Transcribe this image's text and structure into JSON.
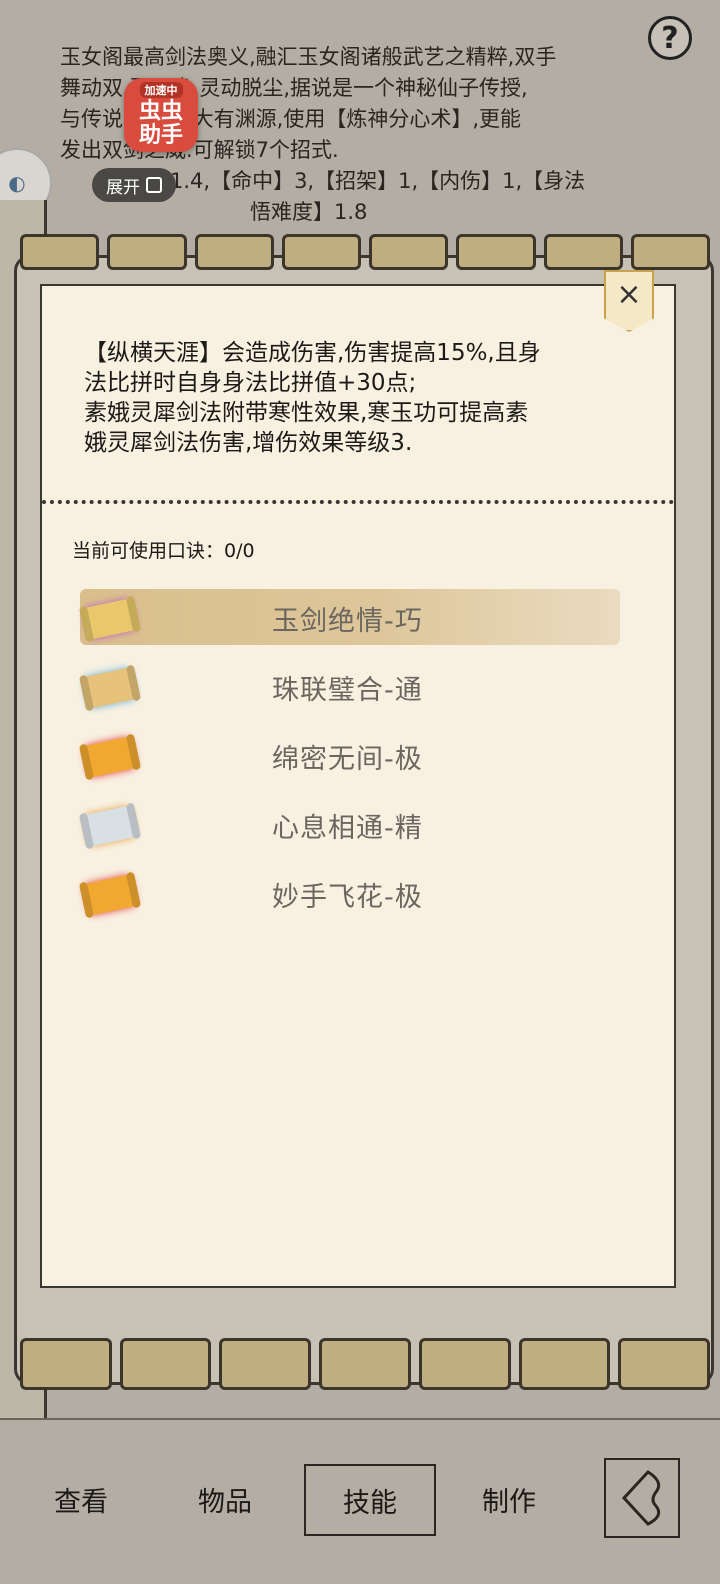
{
  "description": {
    "lines": [
      "玉女阁最高剑法奥义,融汇玉女阁诸般武艺之精粹,双手",
      "舞动双  盈飘逸,灵动脱尘,据说是一个神秘仙子传授,",
      "与传说  素娥墓大有渊源,使用【炼神分心术】,更能",
      "发出双剑之威.可解锁7个招式.",
      "1.4,【命中】3,【招架】1,【内伤】1,【身法",
      "悟难度】1.8"
    ]
  },
  "help_icon_text": "?",
  "overlay": {
    "badge_tag": "加速中",
    "badge_name": "虫虫助手",
    "expand_label": "展开"
  },
  "panel": {
    "close_symbol": "×",
    "effect_text": "【纵横天涯】会造成伤害,伤害提高15%,且身\n法比拼时自身身法比拼值+30点;\n素娥灵犀剑法附带寒性效果,寒玉功可提高素\n娥灵犀剑法伤害,增伤效果等级3.",
    "formula_status": "当前可使用口诀：0/0",
    "formulas": [
      {
        "label": "玉剑绝情-巧",
        "icon": "scroll-purple-icon",
        "color": "#e8c86a",
        "selected": true
      },
      {
        "label": "珠联璧合-通",
        "icon": "scroll-blue-icon",
        "color": "#e6c27a",
        "selected": false
      },
      {
        "label": "绵密无间-极",
        "icon": "scroll-red-icon",
        "color": "#f0a830",
        "selected": false
      },
      {
        "label": "心息相通-精",
        "icon": "scroll-white-icon",
        "color": "#d8e0e4",
        "selected": false
      },
      {
        "label": "妙手飞花-极",
        "icon": "scroll-red-icon",
        "color": "#f0a830",
        "selected": false
      }
    ]
  },
  "nav": {
    "items": [
      "查看",
      "物品",
      "技能",
      "制作"
    ],
    "active_index": 2
  }
}
